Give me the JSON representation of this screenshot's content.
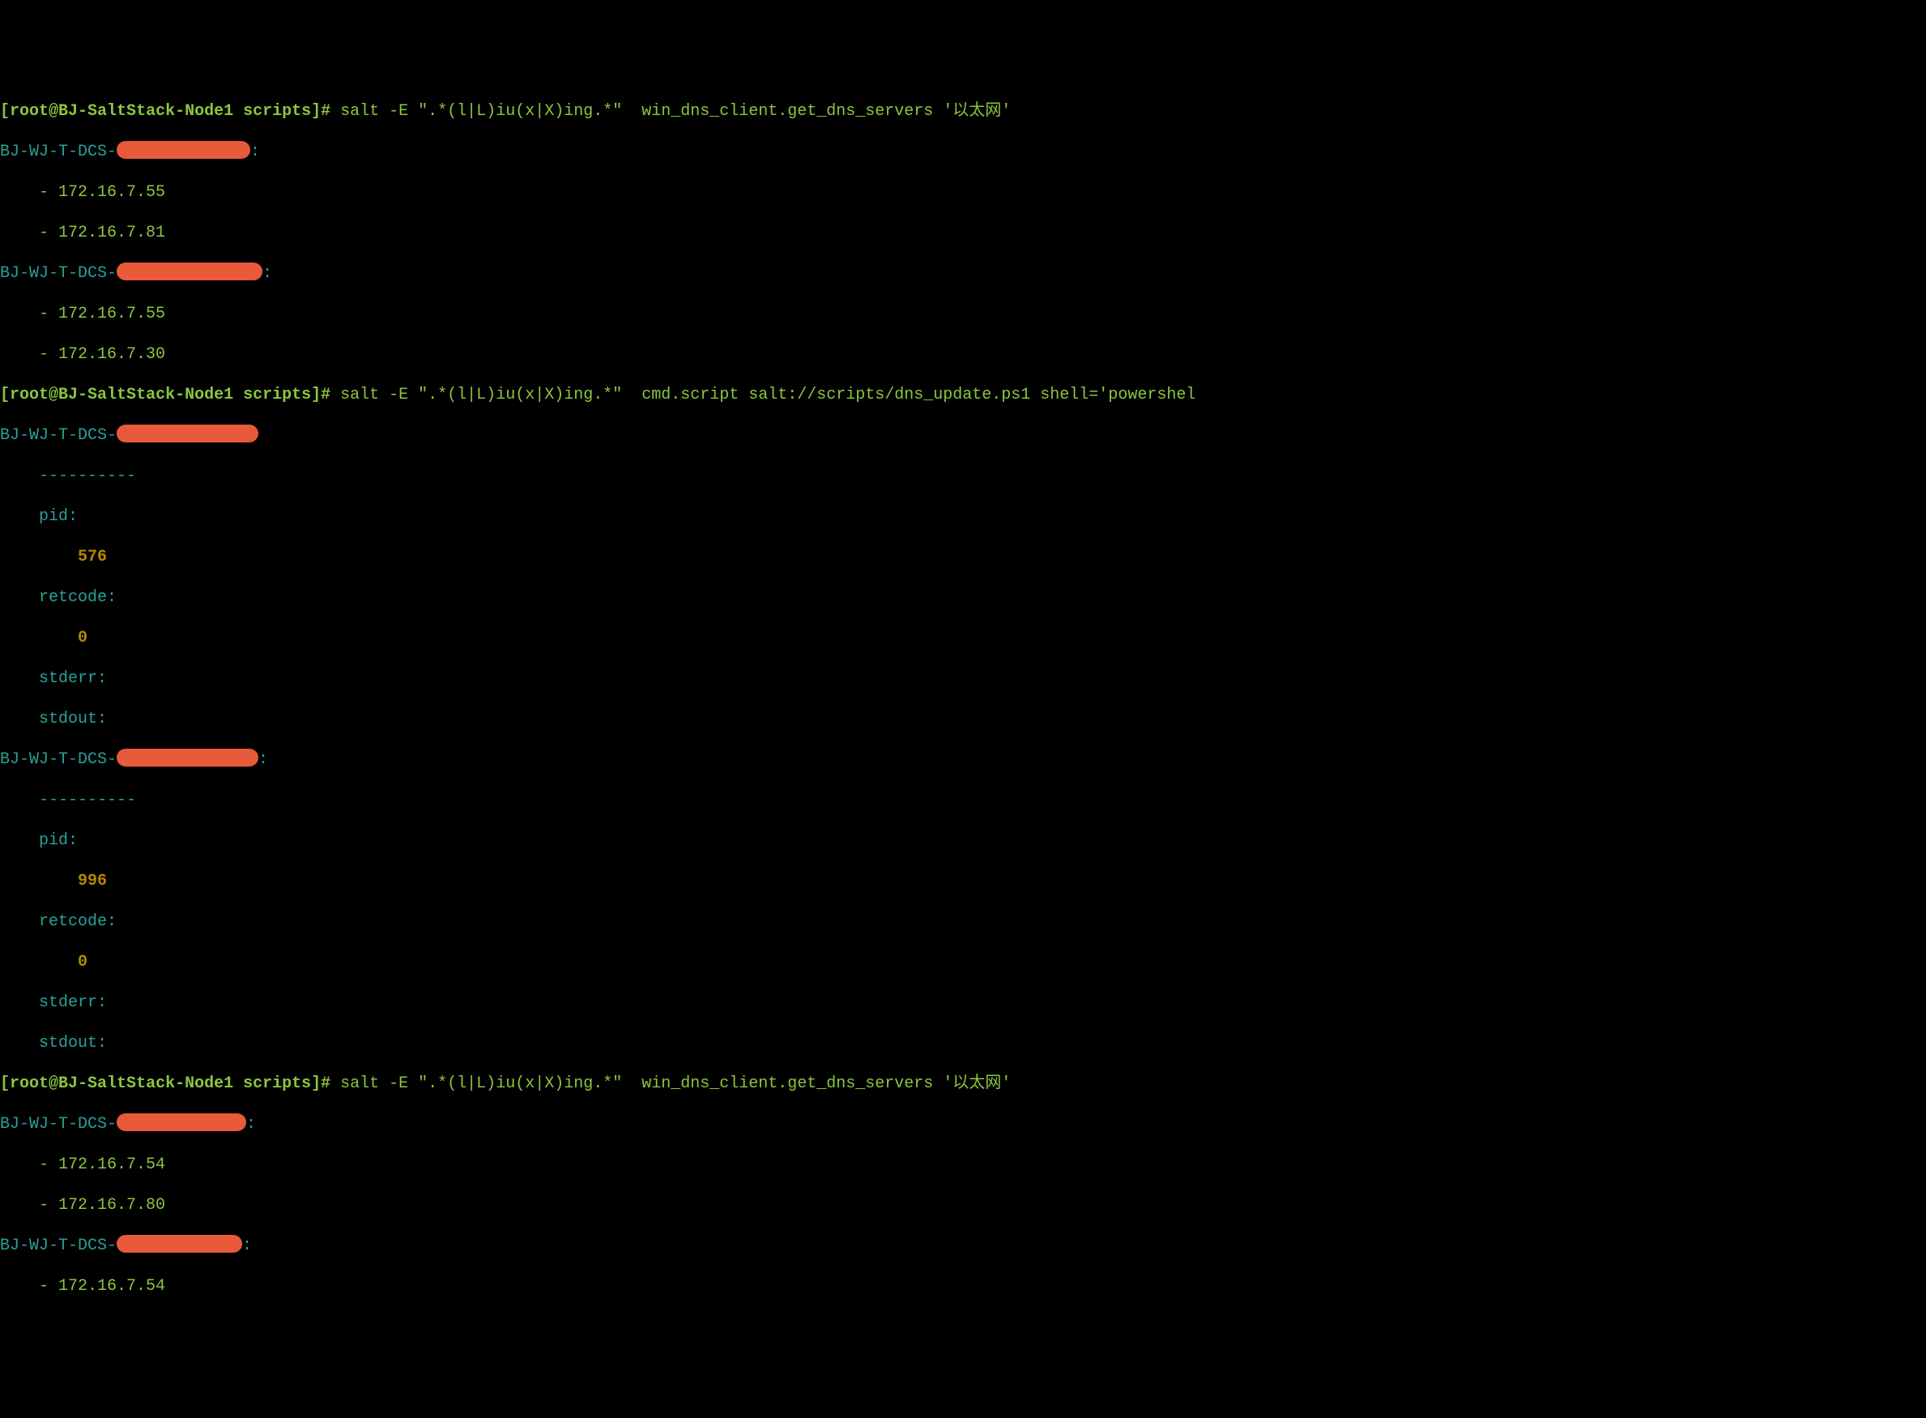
{
  "prompt1": {
    "user": "root",
    "at": "@",
    "host": "BJ-SaltStack-Node1",
    "cwd": "scripts",
    "command": "salt -E \".*(l|L)iu(x|X)ing.*\"  win_dns_client.get_dns_servers '以太网'"
  },
  "output1": {
    "minion1_prefix": "BJ-WJ-T-DCS-",
    "minion1_colon": ":",
    "dns1": "    - 172.16.7.55",
    "dns2": "    - 172.16.7.81",
    "minion2_prefix": "BJ-WJ-T-DCS-",
    "minion2_colon": ":",
    "dns3": "    - 172.16.7.55",
    "dns4": "    - 172.16.7.30"
  },
  "prompt2": {
    "user": "root",
    "at": "@",
    "host": "BJ-SaltStack-Node1",
    "cwd": "scripts",
    "command": "salt -E \".*(l|L)iu(x|X)ing.*\"  cmd.script salt://scripts/dns_update.ps1 shell='powershel"
  },
  "output2": {
    "minion1_prefix": "BJ-WJ-T-DCS-",
    "dashes1": "    ----------",
    "pid_label1": "    pid:",
    "pid_val1": "        576",
    "retcode_label1": "    retcode:",
    "retcode_val1": "        0",
    "stderr_label1": "    stderr:",
    "stdout_label1": "    stdout:",
    "minion2_prefix": "BJ-WJ-T-DCS-",
    "minion2_colon": ":",
    "dashes2": "    ----------",
    "pid_label2": "    pid:",
    "pid_val2": "        996",
    "retcode_label2": "    retcode:",
    "retcode_val2": "        0",
    "stderr_label2": "    stderr:",
    "stdout_label2": "    stdout:"
  },
  "prompt3": {
    "user": "root",
    "at": "@",
    "host": "BJ-SaltStack-Node1",
    "cwd": "scripts",
    "command": "salt -E \".*(l|L)iu(x|X)ing.*\"  win_dns_client.get_dns_servers '以太网'"
  },
  "output3": {
    "minion1_prefix": "BJ-WJ-T-DCS-",
    "minion1_colon": ":",
    "dns1": "    - 172.16.7.54",
    "dns2": "    - 172.16.7.80",
    "minion2_prefix": "BJ-WJ-T-DCS-",
    "minion2_colon": ":",
    "dns3": "    - 172.16.7.54"
  }
}
